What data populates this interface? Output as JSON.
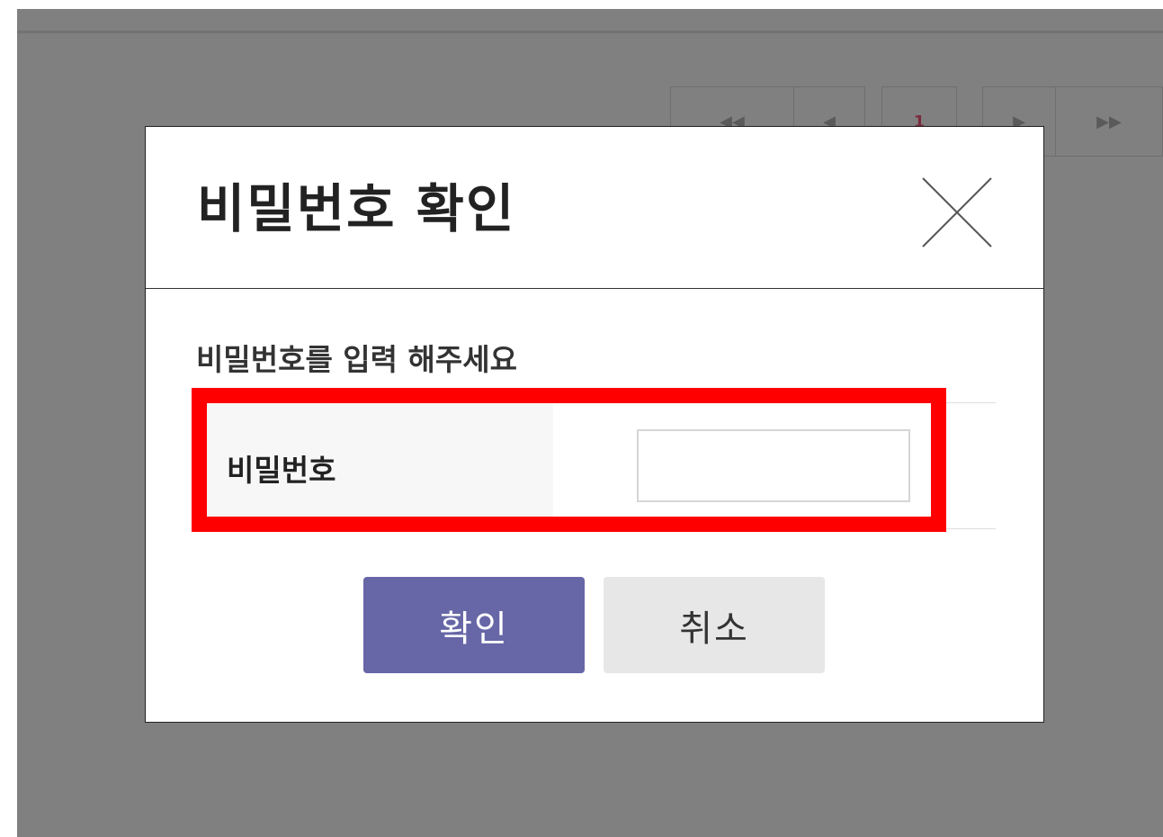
{
  "pagination": {
    "first_icon": "double-chevron-left-icon",
    "prev_icon": "chevron-left-icon",
    "current_page": "1",
    "next_icon": "chevron-right-icon",
    "last_icon": "double-chevron-right-icon",
    "current_color": "#b5174a"
  },
  "modal": {
    "title": "비밀번호 확인",
    "close_icon": "close-icon",
    "prompt": "비밀번호를 입력 해주세요",
    "password_label": "비밀번호",
    "password_value": "",
    "confirm_label": "확인",
    "cancel_label": "취소"
  },
  "colors": {
    "overlay": "#808080",
    "confirm_button": "#6766a7",
    "cancel_button": "#e7e7e7",
    "highlight": "#ff0000"
  }
}
